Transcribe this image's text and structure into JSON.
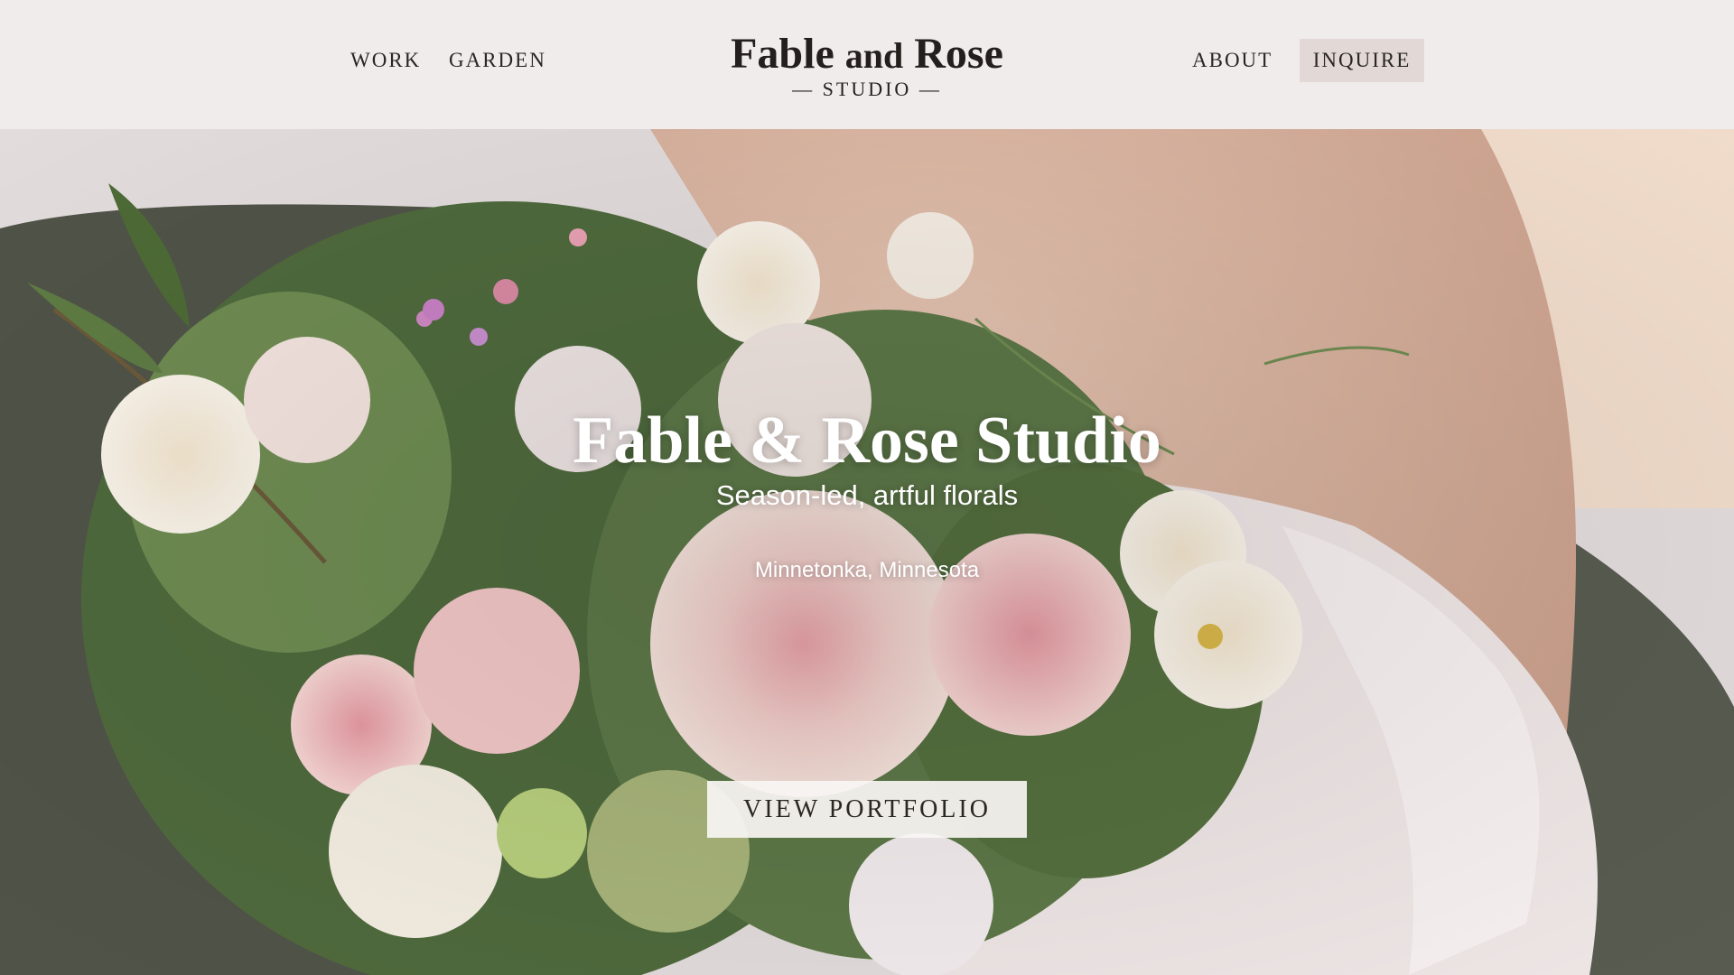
{
  "header": {
    "nav_left": [
      "WORK",
      "GARDEN"
    ],
    "logo": {
      "word1": "Fable",
      "word2": "and",
      "word3": "Rose",
      "subtitle": "— STUDIO —"
    },
    "nav_right": [
      "ABOUT",
      "INQUIRE"
    ]
  },
  "hero": {
    "title": "Fable & Rose Studio",
    "subtitle": "Season-led, artful florals",
    "location": "Minnetonka, Minnesota",
    "cta_label": "VIEW PORTFOLIO",
    "image": "bride-holding-peony-bouquet"
  },
  "colors": {
    "header_bg": "#f1ecec",
    "inquire_bg": "#e2d9d6",
    "text_dark": "#2a2622"
  }
}
